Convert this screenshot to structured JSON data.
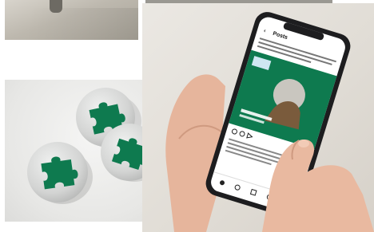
{
  "phone_screen": {
    "header_title": "Posts"
  },
  "colors": {
    "brand_green": "#0e7a4f",
    "pin_silver": "#d6d7d6",
    "skin": "#e8b8a0",
    "phone_body": "#1d1d1f"
  }
}
